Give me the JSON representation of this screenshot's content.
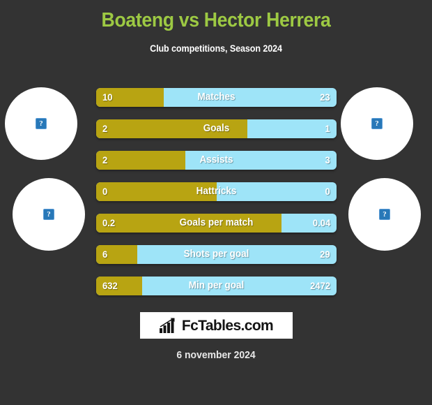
{
  "header": {
    "title": "Boateng vs Hector Herrera",
    "subtitle": "Club competitions, Season 2024",
    "title_color": "#9dc943"
  },
  "colors": {
    "background": "#333333",
    "left_player": "#b8a412",
    "right_player": "#9ee4f8",
    "title": "#9dc943"
  },
  "avatars": [
    {
      "name": "left-player-top",
      "state": "broken-image"
    },
    {
      "name": "left-player-bottom",
      "state": "broken-image"
    },
    {
      "name": "right-player-top",
      "state": "broken-image"
    },
    {
      "name": "right-player-bottom",
      "state": "broken-image"
    }
  ],
  "chart_data": {
    "type": "bar",
    "title": "Boateng vs Hector Herrera",
    "subtitle": "Club competitions, Season 2024",
    "orientation": "horizontal-diverging",
    "legend": [
      "Boateng",
      "Hector Herrera"
    ],
    "categories": [
      "Matches",
      "Goals",
      "Assists",
      "Hattricks",
      "Goals per match",
      "Shots per goal",
      "Min per goal"
    ],
    "series": [
      {
        "name": "Boateng",
        "color": "#b8a412",
        "values": [
          10,
          2,
          2,
          0,
          0.2,
          6,
          632
        ]
      },
      {
        "name": "Hector Herrera",
        "color": "#9ee4f8",
        "values": [
          23,
          1,
          3,
          0,
          0.04,
          29,
          2472
        ]
      }
    ]
  },
  "stats": [
    {
      "label": "Matches",
      "left": "10",
      "right": "23",
      "left_pct": 28
    },
    {
      "label": "Goals",
      "left": "2",
      "right": "1",
      "left_pct": 63
    },
    {
      "label": "Assists",
      "left": "2",
      "right": "3",
      "left_pct": 37
    },
    {
      "label": "Hattricks",
      "left": "0",
      "right": "0",
      "left_pct": 50
    },
    {
      "label": "Goals per match",
      "left": "0.2",
      "right": "0.04",
      "left_pct": 77
    },
    {
      "label": "Shots per goal",
      "left": "6",
      "right": "29",
      "left_pct": 17
    },
    {
      "label": "Min per goal",
      "left": "632",
      "right": "2472",
      "left_pct": 19
    }
  ],
  "footer": {
    "logo_text": "FcTables.com",
    "logo_icon": "bar-chart-icon",
    "date": "6 november 2024"
  }
}
